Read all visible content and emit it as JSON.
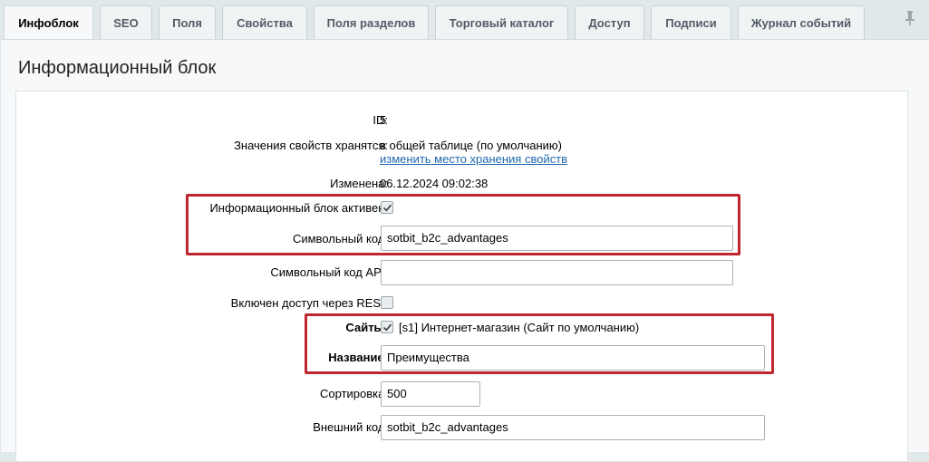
{
  "tabs": [
    {
      "label": "Инфоблок",
      "active": true
    },
    {
      "label": "SEO"
    },
    {
      "label": "Поля"
    },
    {
      "label": "Свойства"
    },
    {
      "label": "Поля разделов"
    },
    {
      "label": "Торговый каталог"
    },
    {
      "label": "Доступ"
    },
    {
      "label": "Подписи"
    },
    {
      "label": "Журнал событий"
    }
  ],
  "icons": {
    "pin": "pin-icon",
    "checkmark": "checkmark-icon"
  },
  "colors": {
    "highlight": "#c0262d",
    "link": "#2067b0"
  },
  "page": {
    "title": "Информационный блок"
  },
  "form": {
    "id": {
      "label": "ID:",
      "value": "5"
    },
    "storage": {
      "label": "Значения свойств хранятся:",
      "value": "в общей таблице (по умолчанию)",
      "link": "изменить место хранения свойств"
    },
    "modified": {
      "label": "Изменена:",
      "value": "06.12.2024 09:02:38"
    },
    "active": {
      "label": "Информационный блок активен:",
      "checked": true
    },
    "code": {
      "label": "Символьный код:",
      "value": "sotbit_b2c_advantages"
    },
    "api_code": {
      "label": "Символьный код API:",
      "value": ""
    },
    "rest": {
      "label": "Включен доступ через REST",
      "checked": false
    },
    "sites": {
      "label": "Сайты:",
      "checked": true,
      "option": "[s1] Интернет-магазин (Сайт по умолчанию)"
    },
    "name": {
      "label": "Название:",
      "value": "Преимущества"
    },
    "sort": {
      "label": "Сортировка:",
      "value": "500"
    },
    "external_code": {
      "label": "Внешний код:",
      "value": "sotbit_b2c_advantages"
    }
  }
}
